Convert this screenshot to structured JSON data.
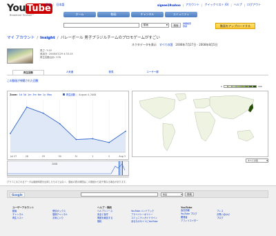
{
  "header": {
    "logo_you": "You",
    "logo_tube": "Tube",
    "tagline": "Broadcast Yourself™",
    "lang_links": [
      "日本",
      "日本語"
    ],
    "user_links": [
      "sigeee19sahoo",
      "アカウント",
      "クイックリスト (0)",
      "ヘルプ",
      "ログアウト"
    ],
    "nav_tabs": [
      "ホーム",
      "動画",
      "チャンネル",
      "コミュニティ"
    ],
    "search_select": "動画",
    "search_button": "検索",
    "search_extra_links": [
      "詳細検索",
      "登録"
    ],
    "upload_button": "動画をアップロードする"
  },
  "breadcrumb": {
    "my_account": "マイ アカウント",
    "separator": "/",
    "insight": "Insight",
    "title": "バレーボール 男子ブラジルチームのプロモゲームがすごい"
  },
  "date_range": {
    "label": "ネクタデータを表示",
    "all_link": "すべての国",
    "range": "2008年7月27日 - 2008年8月5日"
  },
  "video_info": {
    "time": "長さ: 3:22",
    "date": "追加日: 2008/07/29 4:33:15",
    "views": "再生回数合計: 378"
  },
  "tabs": [
    "再生回数",
    "人気度",
    "発見",
    "ユーザー層"
  ],
  "panel_caption": "この動画が視聴された回数",
  "chart_toolbar": {
    "zoom_label": "Zoom:",
    "zoom_options": [
      "1d",
      "5d",
      "1m",
      "3m",
      "6m",
      "1y",
      "Max"
    ],
    "legend_label": "再生回数",
    "date_label": "August 4, 2008"
  },
  "map_legend": {
    "min": "0",
    "max": "300",
    "colors": [
      "#eef3e2",
      "#d5e3b8",
      "#b9d08e",
      "#9dbb66",
      "#7ea340",
      "#5e8a24",
      "#3f6e11",
      "#244f05"
    ]
  },
  "chart_data": {
    "type": "line",
    "x": [
      "Jul 27",
      "28",
      "29",
      "30",
      "31",
      "1",
      "2",
      "Aug 3"
    ],
    "series": [
      {
        "name": "再生回数",
        "values": [
          25,
          60,
          52,
          38,
          17,
          18,
          13,
          28
        ]
      }
    ],
    "ylim": [
      0,
      70
    ],
    "color": "#3366cc",
    "navigator_year": "2008"
  },
  "map_control": "すべての国",
  "bottom_note": "グラフに示されるデータは継続時間を反映したものではなく、動画の表示期間はこの数値から若干異なる場合があります。",
  "footer_search": {
    "google_label": "Google",
    "select_value": "動画",
    "button": "検索"
  },
  "footer": {
    "columns": [
      {
        "title": "ユーザーアカウント",
        "links": [
          "動画",
          "チャンネル",
          "再生リスト"
        ]
      },
      {
        "title": "",
        "links": [
          "受信ボックス",
          "登録チャンネル",
          "お気に入り"
        ]
      },
      {
        "title": "ヘルプ・規約",
        "links": [
          "ヘルプリソース",
          "安全と保守",
          "問題を報告する",
          "規約"
        ]
      },
      {
        "title": "",
        "links": [
          "YouTube ハンドブック",
          "プライバシーポリシー",
          "コミュニティガイドライン",
          "あなたのサイトにYouTube"
        ]
      },
      {
        "title": "YouTube",
        "links": [
          "会社情報",
          "YouTube ブログ",
          "開発者",
          "アフィリエイター"
        ]
      },
      {
        "title": "",
        "links": [
          "プレス",
          "お問い合わせ",
          "ブログ"
        ]
      }
    ]
  }
}
